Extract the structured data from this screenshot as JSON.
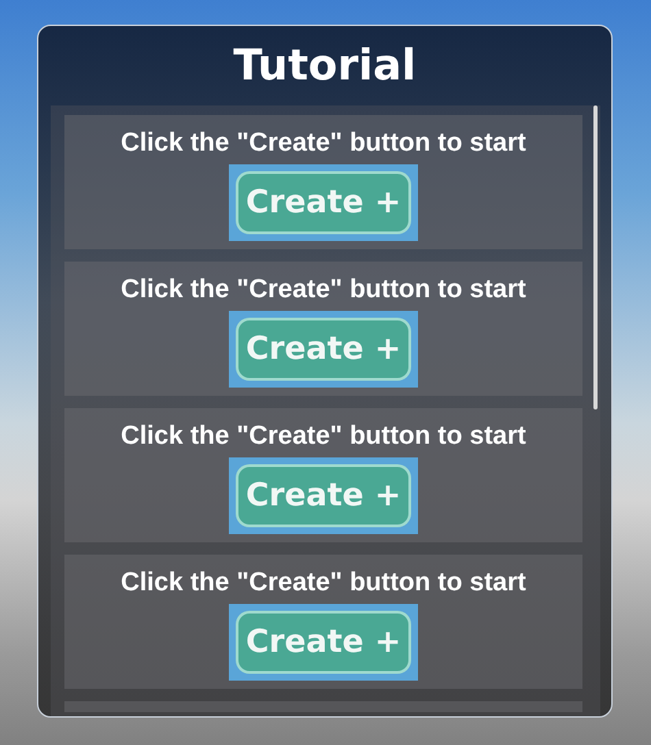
{
  "window": {
    "title": "Tutorial"
  },
  "steps": [
    {
      "text": "Click the \"Create\" button to start",
      "button": "Create +"
    },
    {
      "text": "Click the \"Create\" button to start",
      "button": "Create +"
    },
    {
      "text": "Click the \"Create\" button to start",
      "button": "Create +"
    },
    {
      "text": "Click the \"Create\" button to start",
      "button": "Create +"
    }
  ]
}
